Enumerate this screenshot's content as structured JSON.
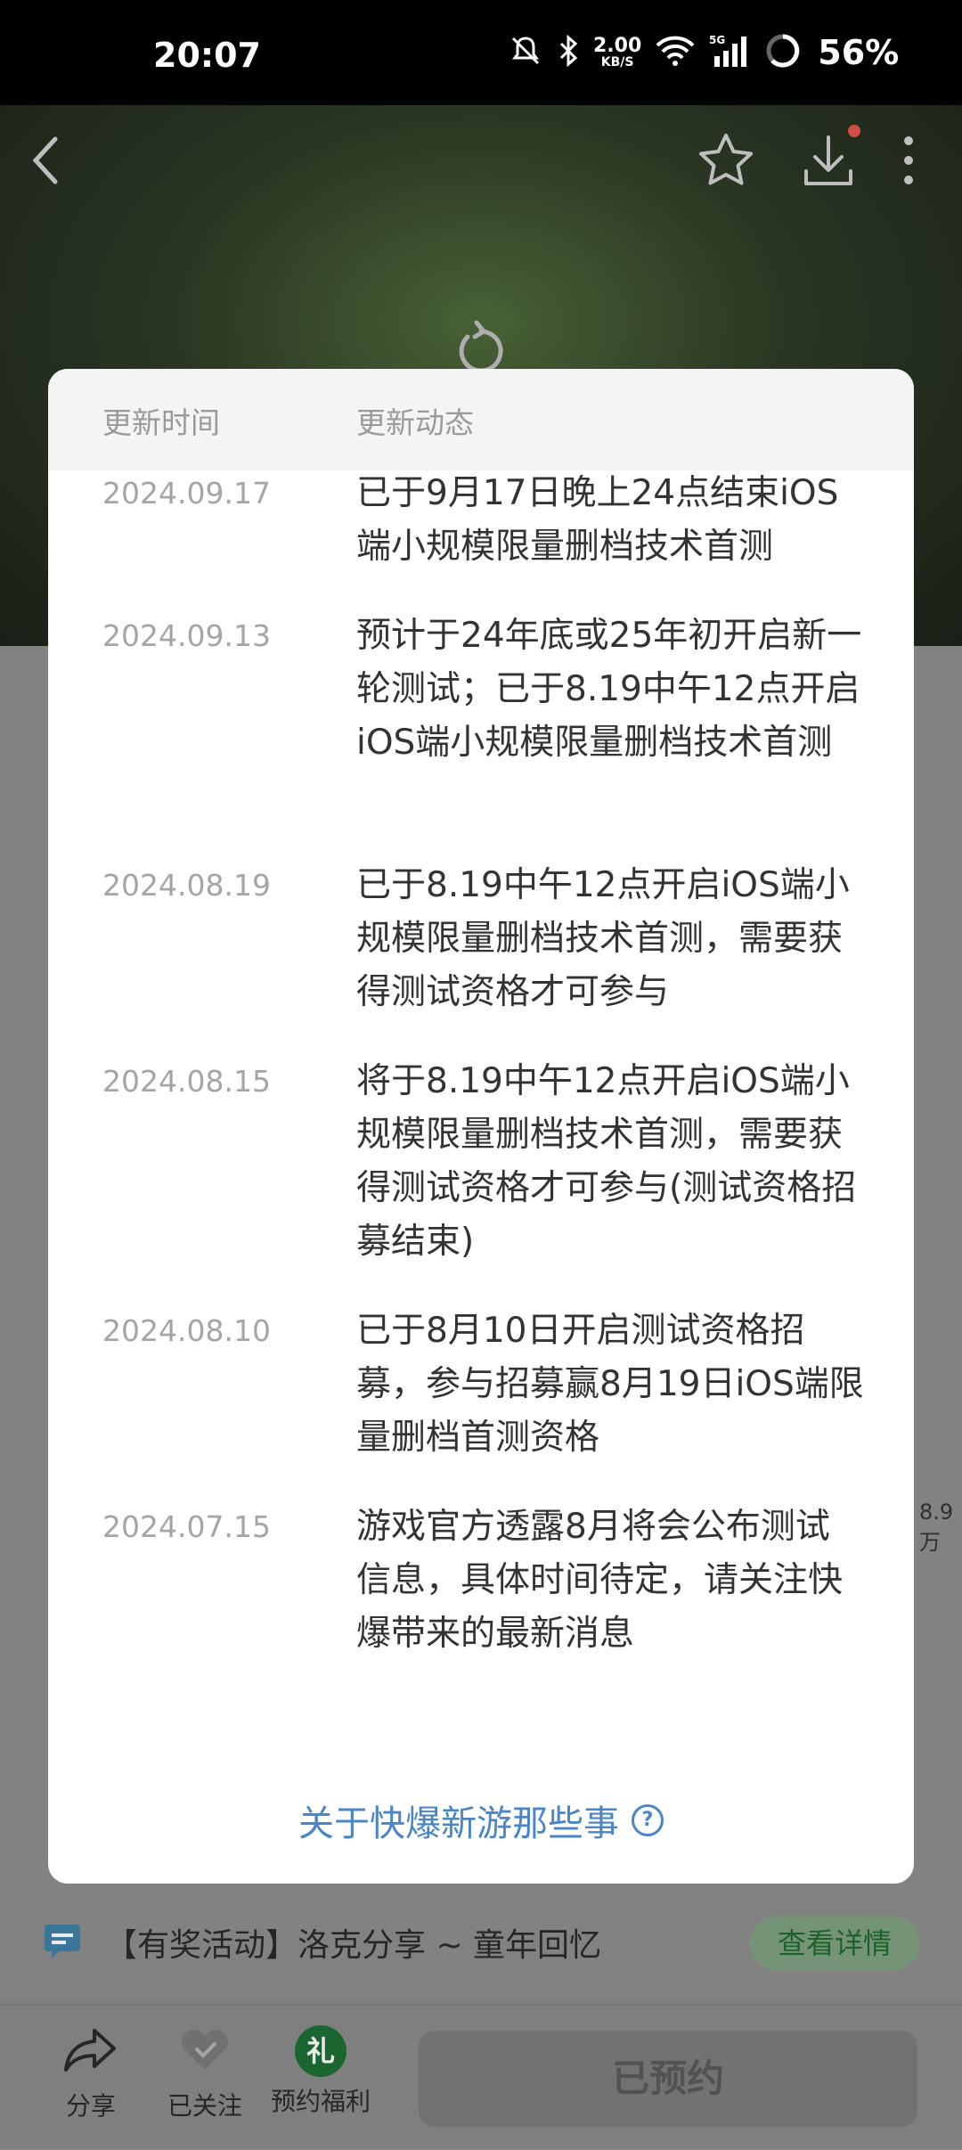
{
  "status_bar": {
    "time": "20:07",
    "net_speed": "2.00",
    "net_unit": "KB/S",
    "cell": "5G",
    "battery": "56%"
  },
  "modal": {
    "header": {
      "col_time": "更新时间",
      "col_news": "更新动态"
    },
    "entries": [
      {
        "date": "2024.09.17",
        "text": "已于9月17日晚上24点结束iOS端小规模限量删档技术首测"
      },
      {
        "date": "2024.09.13",
        "text": "预计于24年底或25年初开启新一轮测试；已于8.19中午12点开启iOS端小规模限量删档技术首测"
      },
      {
        "date": "2024.08.19",
        "text": "已于8.19中午12点开启iOS端小规模限量删档技术首测，需要获得测试资格才可参与"
      },
      {
        "date": "2024.08.15",
        "text": "将于8.19中午12点开启iOS端小规模限量删档技术首测，需要获得测试资格才可参与(测试资格招募结束)"
      },
      {
        "date": "2024.08.10",
        "text": "已于8月10日开启测试资格招募，参与招募赢8月19日iOS端限量删档首测资格"
      },
      {
        "date": "2024.07.15",
        "text": "游戏官方透露8月将会公布测试信息，具体时间待定，请关注快爆带来的最新消息"
      }
    ],
    "footer_link": "关于快爆新游那些事"
  },
  "background": {
    "activity_text": "【有奖活动】洛克分享 ~ 童年回忆",
    "activity_button": "查看详情",
    "side_count": "8.9万",
    "bottom_bar": {
      "share": "分享",
      "followed": "已关注",
      "gift_glyph": "礼",
      "reserve_welfare": "预约福利",
      "reserved": "已预约"
    }
  },
  "colors": {
    "link": "#4a86c5",
    "accent_green": "#1e6e35",
    "status_bg": "#000000"
  }
}
